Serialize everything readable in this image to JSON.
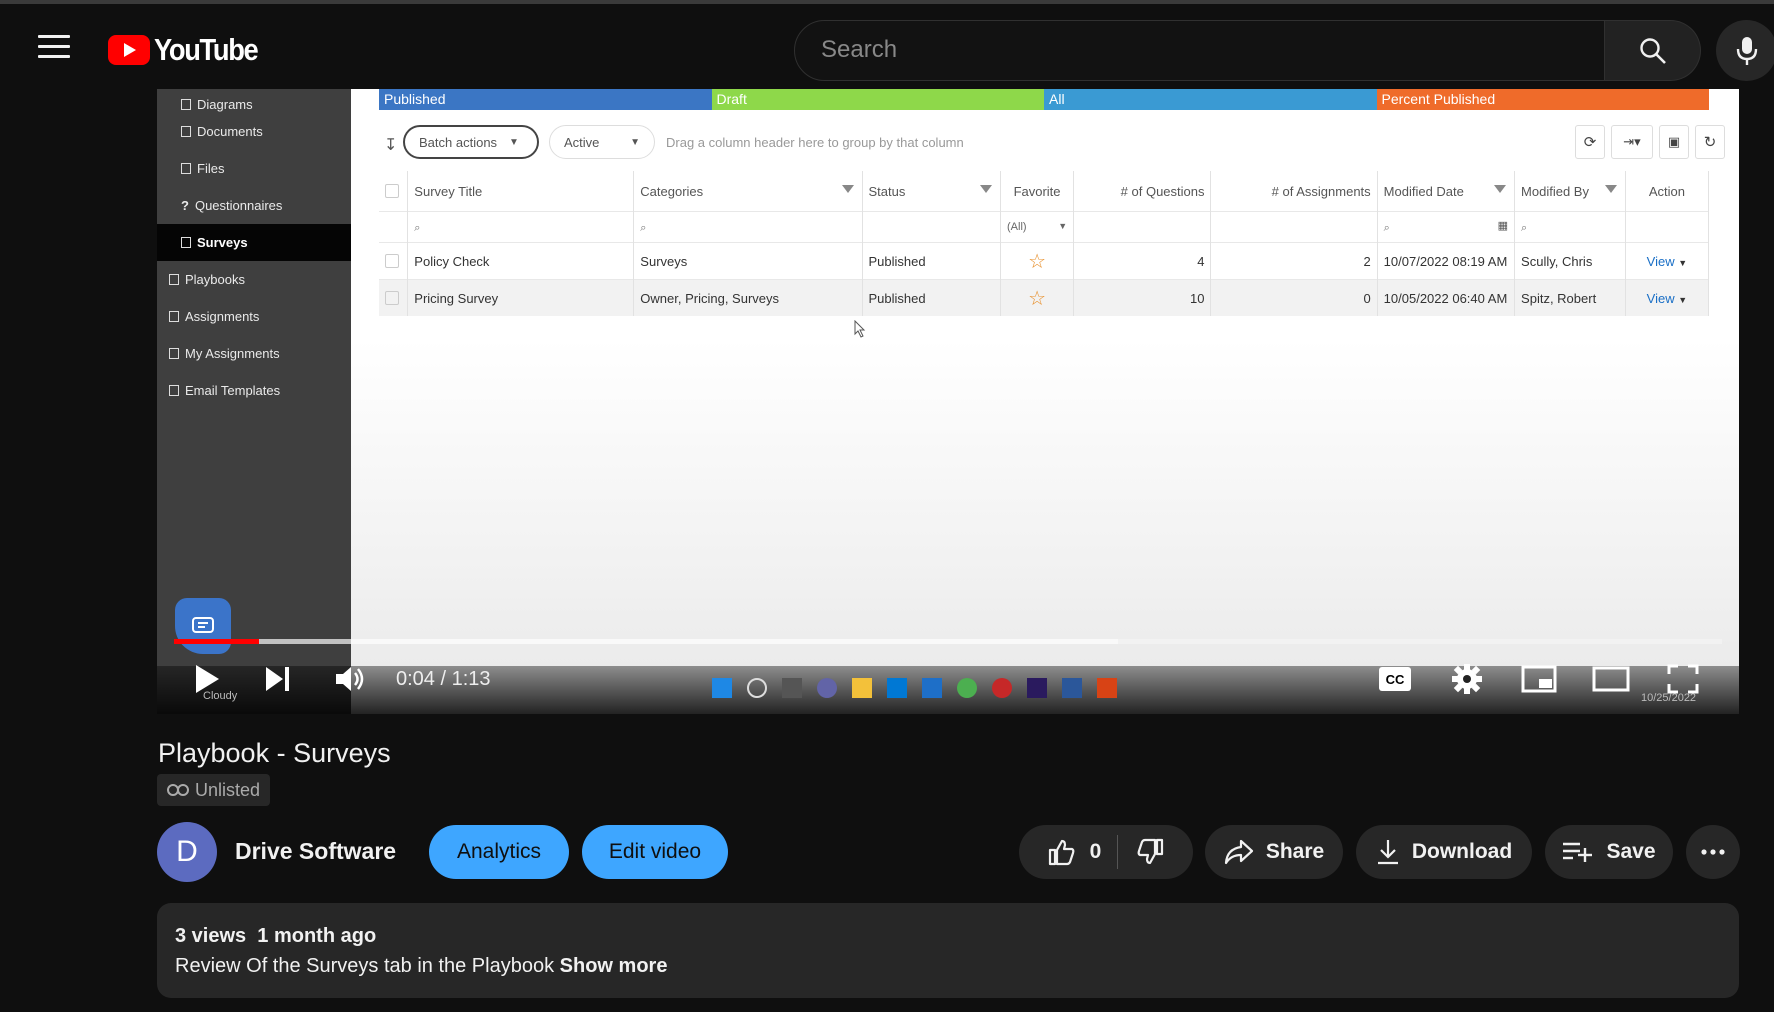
{
  "header": {
    "logo_text": "YouTube",
    "search_placeholder": "Search"
  },
  "app": {
    "sidebar": [
      {
        "label": "Diagrams",
        "sub": true
      },
      {
        "label": "Documents",
        "sub": true
      },
      {
        "label": "Files",
        "sub": true
      },
      {
        "label": "Questionnaires",
        "sub": true
      },
      {
        "label": "Surveys",
        "sub": true,
        "active": true
      },
      {
        "label": "Playbooks",
        "sub": false
      },
      {
        "label": "Assignments",
        "sub": false
      },
      {
        "label": "My Assignments",
        "sub": false
      },
      {
        "label": "Email Templates",
        "sub": false
      }
    ],
    "status_bar": [
      {
        "label": "Published",
        "color": "#3b76c4"
      },
      {
        "label": "Draft",
        "color": "#8ed84a"
      },
      {
        "label": "All",
        "color": "#3a9ad3"
      },
      {
        "label": "Percent Published",
        "color": "#ef6b2a"
      }
    ],
    "toolbar": {
      "batch_label": "Batch actions",
      "filter_label": "Active",
      "group_hint": "Drag a column header here to group by that column"
    },
    "columns": [
      "Survey Title",
      "Categories",
      "Status",
      "Favorite",
      "# of Questions",
      "# of Assignments",
      "Modified Date",
      "Modified By",
      "Action"
    ],
    "favorite_filter": "(All)",
    "rows": [
      {
        "title": "Policy Check",
        "categories": "Surveys",
        "status": "Published",
        "questions": "4",
        "assignments": "2",
        "modified_date": "10/07/2022 08:19 AM",
        "modified_by": "Scully, Chris",
        "action": "View"
      },
      {
        "title": "Pricing Survey",
        "categories": "Owner, Pricing, Surveys",
        "status": "Published",
        "questions": "10",
        "assignments": "0",
        "modified_date": "10/05/2022 06:40 AM",
        "modified_by": "Spitz, Robert",
        "action": "View"
      }
    ],
    "taskbar": {
      "weather": "Cloudy",
      "date": "10/25/2022"
    }
  },
  "player": {
    "current_time": "0:04",
    "duration": "1:13",
    "time_display": "0:04 / 1:13",
    "progress_fraction": 0.055,
    "buffered_fraction": 0.61
  },
  "video": {
    "title": "Playbook - Surveys",
    "visibility": "Unlisted"
  },
  "channel": {
    "avatar_letter": "D",
    "name": "Drive Software",
    "avatar_color": "#5c6bc0"
  },
  "actions": {
    "analytics": "Analytics",
    "edit": "Edit video",
    "like_count": "0",
    "share": "Share",
    "download": "Download",
    "save": "Save"
  },
  "description": {
    "meta": "3 views  1 month ago",
    "text": "Review Of the Surveys tab in the Playbook",
    "show_more": "Show more"
  }
}
